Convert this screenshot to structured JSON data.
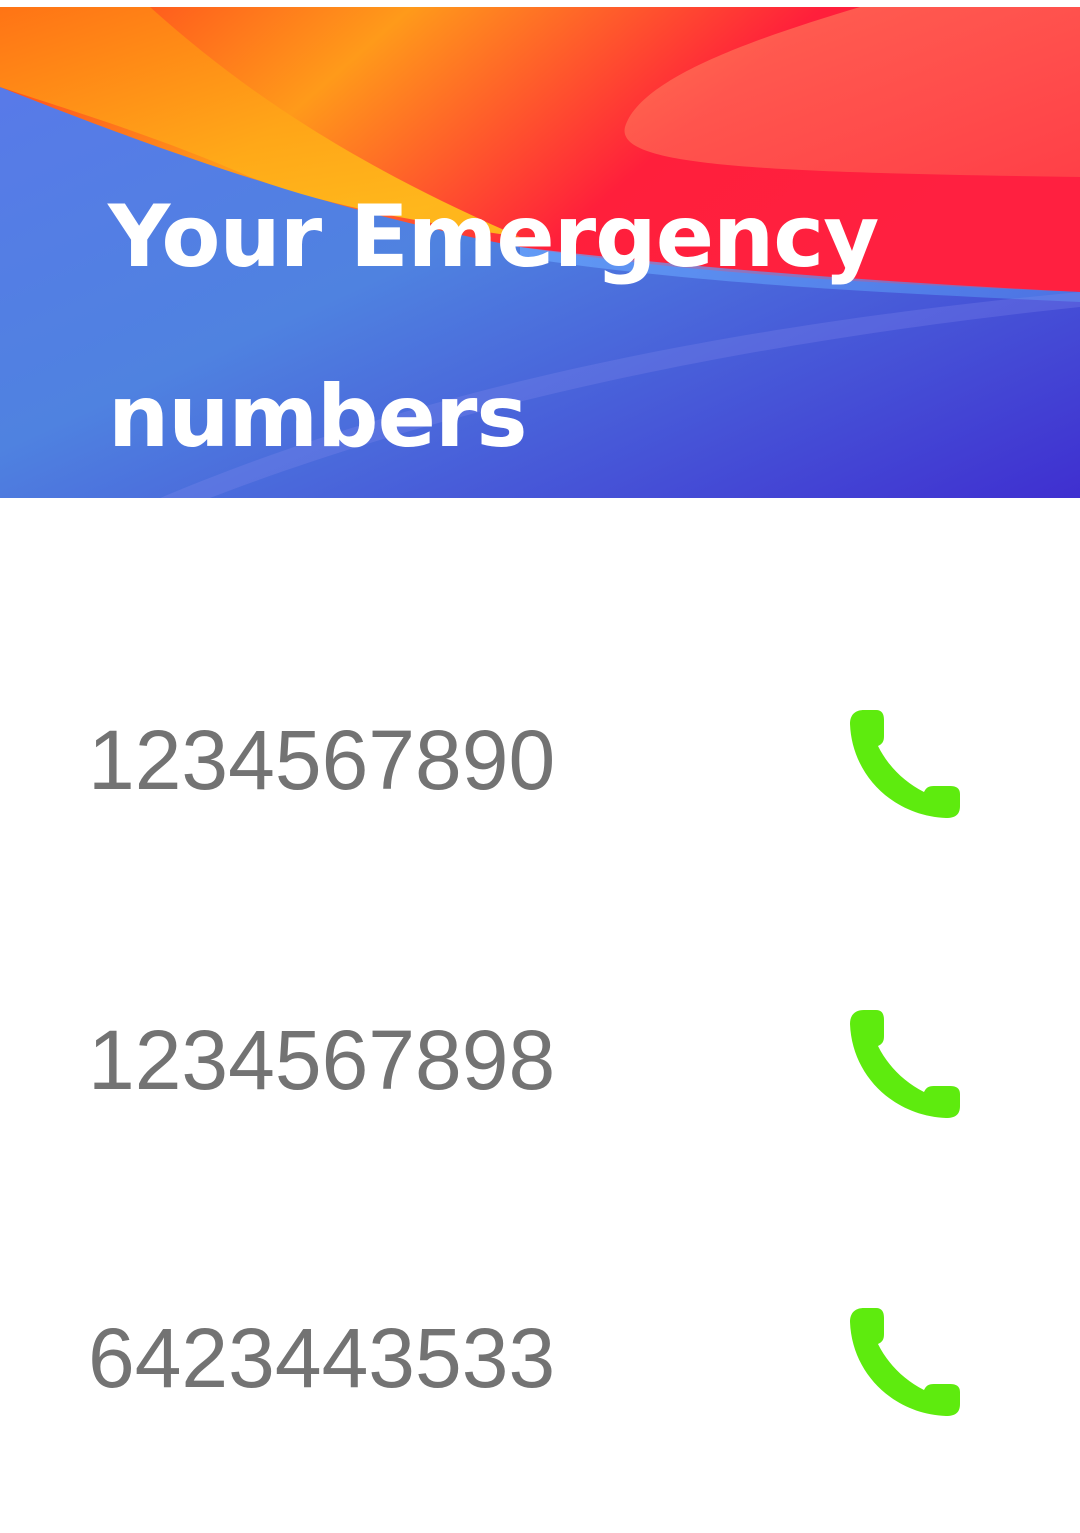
{
  "header": {
    "title_line1": "Your Emergency",
    "title_line2": "numbers"
  },
  "colors": {
    "call_icon": "#5EEB0E",
    "number_text": "#737373",
    "header_blue": "#4A6FE0",
    "header_red": "#FF1F3D",
    "header_orange": "#FF9A1F"
  },
  "contacts": [
    {
      "number": "1234567890",
      "icon": "phone-icon"
    },
    {
      "number": "1234567898",
      "icon": "phone-icon"
    },
    {
      "number": "6423443533",
      "icon": "phone-icon"
    }
  ]
}
